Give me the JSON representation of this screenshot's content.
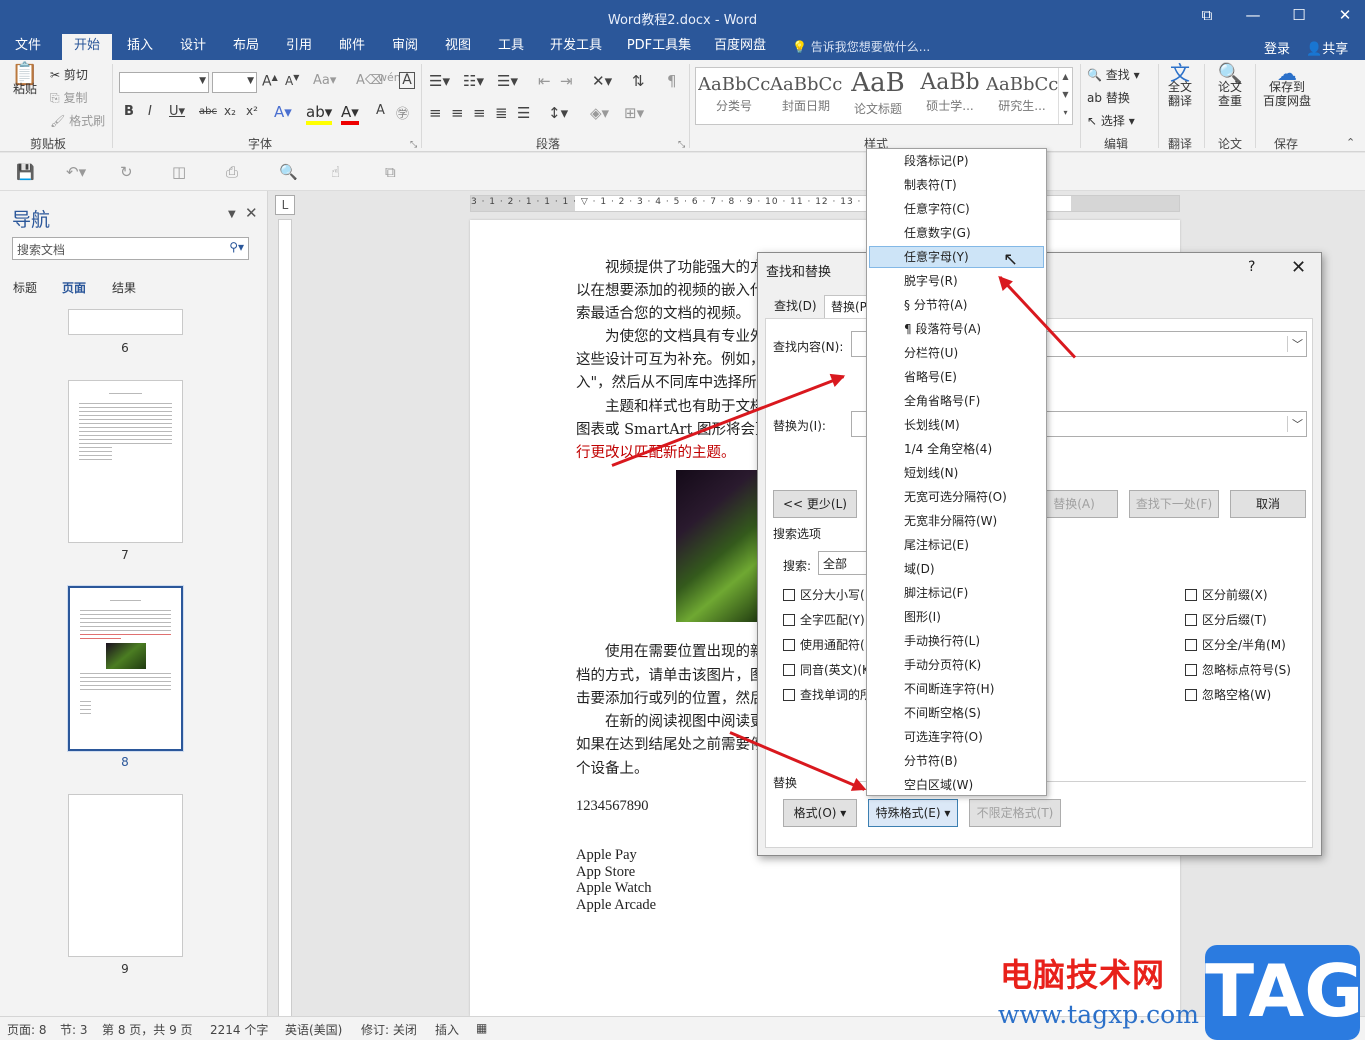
{
  "window": {
    "title": "Word教程2.docx - Word",
    "controls": [
      "⧉",
      "—",
      "☐",
      "✕"
    ]
  },
  "tabs": [
    "文件",
    "开始",
    "插入",
    "设计",
    "布局",
    "引用",
    "邮件",
    "审阅",
    "视图",
    "工具",
    "开发工具",
    "PDF工具集",
    "百度网盘"
  ],
  "tell_me": "告诉我您想要做什么...",
  "login": "登录",
  "share": "共享",
  "ribbon": {
    "clipboard": {
      "paste": "粘贴",
      "cut": "剪切",
      "copy": "复制",
      "format_painter": "格式刷",
      "label": "剪贴板"
    },
    "font": {
      "label": "字体"
    },
    "paragraph": {
      "label": "段落"
    },
    "styles": {
      "label": "样式",
      "items": [
        {
          "preview": "AaBbCc",
          "name": "分类号"
        },
        {
          "preview": "AaBbCc",
          "name": "封面日期"
        },
        {
          "preview": "AaB",
          "name": "论文标题"
        },
        {
          "preview": "AaBb",
          "name": "硕士学..."
        },
        {
          "preview": "AaBbCc",
          "name": "研究生..."
        }
      ]
    },
    "editing": {
      "find": "查找",
      "replace": "替换",
      "select": "选择",
      "label": "编辑"
    },
    "translate": {
      "btn": "全文\n翻译",
      "label": "翻译"
    },
    "paper": {
      "btn": "论文\n查重",
      "label": "论文"
    },
    "save": {
      "btn": "保存到\n百度网盘",
      "label": "保存"
    }
  },
  "nav": {
    "title": "导航",
    "search_placeholder": "搜索文档",
    "tabs": [
      "标题",
      "页面",
      "结果"
    ],
    "pages": [
      "6",
      "7",
      "8",
      "9"
    ]
  },
  "ruler": {
    "h": "3 · 1 · 2 · 1 · 1 · 1 · ▽ · 1 · 2 · 3 · 4 · 5 · 6 · 7 · 8 · 9 · 10 · 11 · 12 · 13 · 14 · 15 · 16 · 17 ·",
    "corner": "L"
  },
  "document": {
    "paragraphs": [
      "视频提供了功能强大的方",
      "以在想要添加的视频的嵌入代",
      "索最适合您的文档的视频。",
      "为使您的文档具有专业外",
      "这些设计可互为补充。例如，",
      "入\"，然后从不同库中选择所",
      "主题和样式也有助于文档",
      "图表或 SmartArt 图形将会更",
      "行更改以匹配新的主题。",
      "使用在需要位置出现的新",
      "档的方式，请单击该图片，图",
      "击要添加行或列的位置，然后",
      "在新的阅读视图中阅读更",
      "如果在达到结尾处之前需要停",
      "个设备上。"
    ],
    "number_line": "1234567890",
    "apple_list": [
      "Apple Pay",
      "App Store",
      "Apple Watch",
      "Apple Arcade"
    ]
  },
  "dialog": {
    "title": "查找和替换",
    "help": "?",
    "close": "✕",
    "tabs": [
      "查找(D)",
      "替换(P"
    ],
    "find_label": "查找内容(N):",
    "replace_label": "替换为(I):",
    "btn_less": "<< 更少(L)",
    "btn_replace_all": "替换(A)",
    "btn_find_next": "查找下一处(F)",
    "btn_cancel": "取消",
    "search_options_label": "搜索选项",
    "search_label": "搜索:",
    "search_value": "全部",
    "left_checks": [
      "区分大小写(",
      "全字匹配(Y)",
      "使用通配符(",
      "同音(英文)(K",
      "查找单词的所"
    ],
    "right_checks": [
      "区分前缀(X)",
      "区分后缀(T)",
      "区分全/半角(M)",
      "忽略标点符号(S)",
      "忽略空格(W)"
    ],
    "replace_section": "替换",
    "btn_format": "格式(O) ▾",
    "btn_special": "特殊格式(E) ▾",
    "btn_no_format": "不限定格式(T)"
  },
  "menu": {
    "items": [
      "段落标记(P)",
      "制表符(T)",
      "任意字符(C)",
      "任意数字(G)",
      "任意字母(Y)",
      "脱字号(R)",
      "§ 分节符(A)",
      "¶ 段落符号(A)",
      "分栏符(U)",
      "省略号(E)",
      "全角省略号(F)",
      "长划线(M)",
      "1/4 全角空格(4)",
      "短划线(N)",
      "无宽可选分隔符(O)",
      "无宽非分隔符(W)",
      "尾注标记(E)",
      "域(D)",
      "脚注标记(F)",
      "图形(I)",
      "手动换行符(L)",
      "手动分页符(K)",
      "不间断连字符(H)",
      "不间断空格(S)",
      "可选连字符(O)",
      "分节符(B)",
      "空白区域(W)"
    ],
    "highlighted_index": 4
  },
  "status": {
    "page": "页面: 8",
    "section": "节: 3",
    "page_of": "第 8 页，共 9 页",
    "words": "2214 个字",
    "language": "英语(美国)",
    "track": "修订: 关闭",
    "insert": "插入"
  },
  "watermark": {
    "cn": "电脑技术网",
    "url": "www.tagxp.com",
    "tag": "TAG"
  },
  "colors": {
    "brand": "#2b579a",
    "arrow": "#d9181e",
    "red_text": "#c00000"
  }
}
